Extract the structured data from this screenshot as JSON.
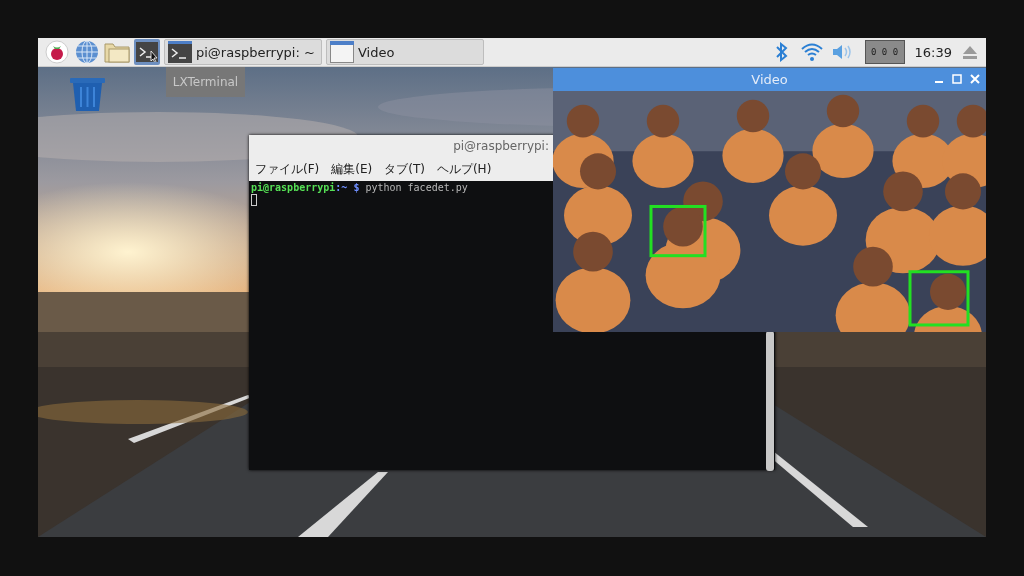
{
  "taskbar": {
    "tasks": [
      {
        "label": "pi@raspberrypi: ~",
        "kind": "terminal",
        "selected": false
      },
      {
        "label": "Video",
        "kind": "window",
        "selected": false
      }
    ],
    "tooltip": "LXTerminal",
    "cpu_monitor": "0 0 0",
    "clock": "16:39"
  },
  "terminal": {
    "title": "pi@raspberrypi:",
    "menu": [
      "ファイル(F)",
      "編集(E)",
      "タブ(T)",
      "ヘルプ(H)"
    ],
    "lines": [
      {
        "user": "pi@raspberrypi",
        "path": ":~",
        "symbol": "$",
        "command": "python facedet.py"
      }
    ]
  },
  "video": {
    "title": "Video"
  }
}
